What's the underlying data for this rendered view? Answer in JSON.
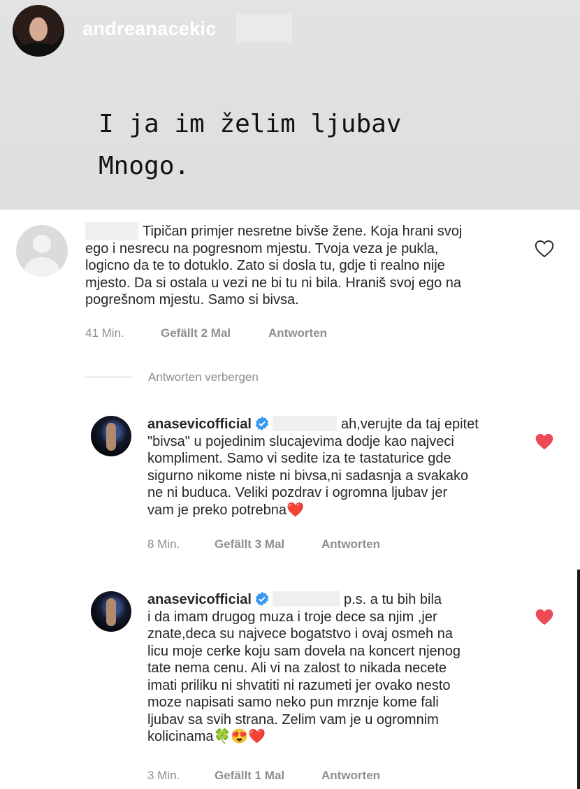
{
  "story": {
    "username": "andreanacekic",
    "line1": "I ja im želim ljubav",
    "line2": "Mnogo."
  },
  "comments": [
    {
      "text_line1": "Tipičan primjer nesretne bivše žene. Koja hrani svoj",
      "text_line2": "ego i nesrecu na pogresnom mjestu. Tvoja veza je pukla,",
      "text_line3": "logicno da te to dotuklo. Zato si dosla tu, gdje ti realno nije",
      "text_line4": "mjesto. Da si ostala u vezi ne bi tu ni bila. Hraniš svoj ego na",
      "text_line5": "pogrešnom mjestu. Samo si bivsa.",
      "time": "41 Min.",
      "likes": "Gefällt 2 Mal",
      "reply": "Antworten"
    }
  ],
  "hide_replies": "Antworten verbergen",
  "replies": [
    {
      "username": "anasevicofficial",
      "line1": "ah,verujte da taj epitet",
      "line2": "\"bivsa\" u pojedinim slucajevima dodje kao najveci",
      "line3": "kompliment. Samo vi sedite iza te tastaturice  gde",
      "line4": "sigurno nikome niste ni bivsa,ni sadasnja a svakako",
      "line5": "ne ni buduca. Veliki pozdrav i ogromna ljubav jer",
      "line6": "vam je preko potrebna❤️",
      "time": "8 Min.",
      "likes": "Gefällt 3 Mal",
      "reply": "Antworten"
    },
    {
      "username": "anasevicofficial",
      "line1": "p.s. a tu bih bila",
      "line2": "i da imam drugog muza i troje dece sa njim ,jer",
      "line3": "znate,deca su najvece bogatstvo i ovaj osmeh na",
      "line4": "licu moje cerke koju sam dovela na koncert njenog",
      "line5": "tate nema cenu. Ali vi na zalost to nikada necete",
      "line6": "imati priliku ni shvatiti ni razumeti jer ovako nesto",
      "line7": "moze napisati samo neko pun mrznje kome fali",
      "line8": "ljubav sa svih strana. Zelim vam je u ogromnim",
      "line9": "kolicinama🍀😍❤️",
      "time": "3 Min.",
      "likes": "Gefällt 1 Mal",
      "reply": "Antworten"
    }
  ],
  "colors": {
    "like_red": "#ed4956",
    "verified_blue": "#3897f0",
    "meta_gray": "#8e8e8e"
  },
  "icons": [
    "heart-outline-icon",
    "heart-filled-icon",
    "verified-badge-icon"
  ]
}
